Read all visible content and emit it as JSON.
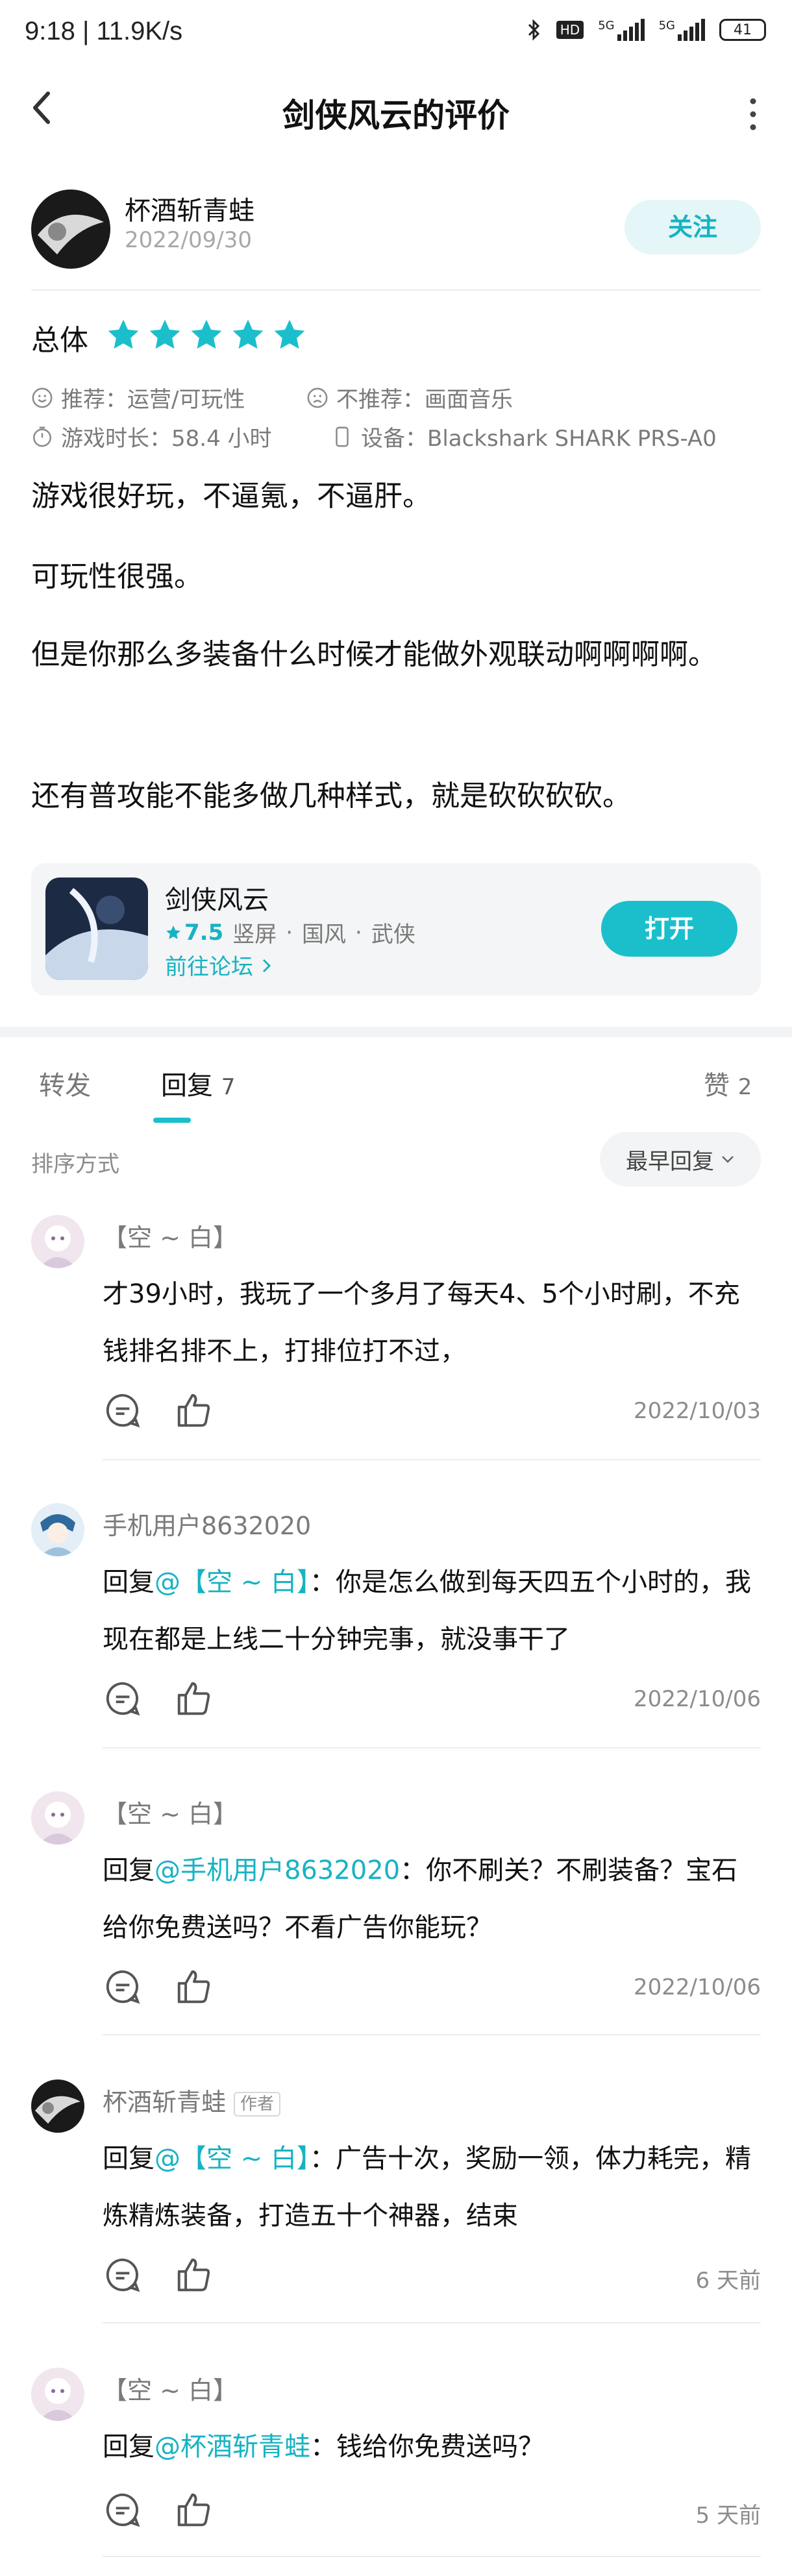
{
  "status_bar": {
    "time": "9:18 | 11.9K/s",
    "hd": "HD",
    "net1": "5G",
    "net2": "5G",
    "battery": "41"
  },
  "nav": {
    "title": "剑侠风云的评价"
  },
  "author": {
    "name": "杯酒斩青蛙",
    "date": "2022/09/30",
    "follow_label": "关注"
  },
  "rating": {
    "overall_label": "总体",
    "stars": 5,
    "max_stars": 5
  },
  "meta": {
    "recommend": "推荐：运营/可玩性",
    "not_recommend": "不推荐：画面音乐",
    "play_time": "游戏时长：58.4 小时",
    "device": "设备：Blackshark SHARK PRS-A0"
  },
  "review": {
    "p1": "游戏很好玩，不逼氪，不逼肝。",
    "p2": "可玩性很强。",
    "p3": "但是你那么多装备什么时候才能做外观联动啊啊啊啊。",
    "p4": "还有普攻能不能多做几种样式，就是砍砍砍砍。"
  },
  "game_card": {
    "name": "剑侠风云",
    "score": "7.5",
    "tags": [
      "竖屏",
      "国风",
      "武侠"
    ],
    "tag_sep": "·",
    "forum_label": "前往论坛",
    "open_label": "打开"
  },
  "tabs": {
    "forward": "转发",
    "reply": "回复",
    "reply_count": "7",
    "like": "赞",
    "like_count": "2"
  },
  "sort": {
    "label": "排序方式",
    "selected": "最早回复"
  },
  "replies": [
    {
      "name": "【空 ~ 白】",
      "prefix": "",
      "mention": "",
      "text": "才39小时，我玩了一个多月了每天4、5个小时刷，不充钱排名排不上，打排位打不过，",
      "date": "2022/10/03"
    },
    {
      "name": "手机用户8632020",
      "prefix": "回复",
      "mention": "@【空 ~ 白】",
      "text": "：你是怎么做到每天四五个小时的，我现在都是上线二十分钟完事，就没事干了",
      "date": "2022/10/06"
    },
    {
      "name": "【空 ~ 白】",
      "prefix": "回复",
      "mention": "@手机用户8632020",
      "text": "：你不刷关？不刷装备？宝石给你免费送吗？不看广告你能玩？",
      "date": "2022/10/06"
    },
    {
      "name": "杯酒斩青蛙",
      "tag": "作者",
      "prefix": "回复",
      "mention": "@【空 ~ 白】",
      "text": "：广告十次，奖励一领，体力耗完，精炼精炼装备，打造五十个神器，结束",
      "date": "6 天前"
    },
    {
      "name": "【空 ~ 白】",
      "prefix": "回复",
      "mention": "@杯酒斩青蛙",
      "text": "：钱给你免费送吗？",
      "date": "5 天前"
    }
  ],
  "colors": {
    "accent": "#1bbfcc",
    "accent_text": "#16b3c3",
    "follow_bg": "#e4f6f7"
  }
}
